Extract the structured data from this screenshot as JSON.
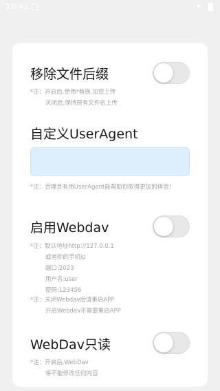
{
  "status_bar": {
    "time": "10:41"
  },
  "settings": {
    "remove_suffix": {
      "title": "移除文件后缀",
      "note_line1": "*注：开启后,使用*替换.加密上传",
      "note_line2": "关闭后,保持原有文件名上传",
      "enabled": false
    },
    "user_agent": {
      "title": "自定义UserAgent",
      "value": "",
      "placeholder": "",
      "note": "*注：合理且有用UserAgent能帮助你取得更加的体验!"
    },
    "webdav": {
      "title": "启用Webdav",
      "enabled": false,
      "note_lines": [
        "*注：默认地址http://127.0.0.1",
        "或者你的手机ip",
        "端口:2023",
        "用户名:user",
        "密码:123456"
      ],
      "note2_line1": "*注：关闭Webdav后请重启APP",
      "note2_line2": "开启Webdav不需要重启APP"
    },
    "webdav_readonly": {
      "title": "WebDav只读",
      "enabled": false,
      "note_line1": "*注：开启后,WebDav",
      "note_line2": "将不能修改任何内容"
    }
  }
}
